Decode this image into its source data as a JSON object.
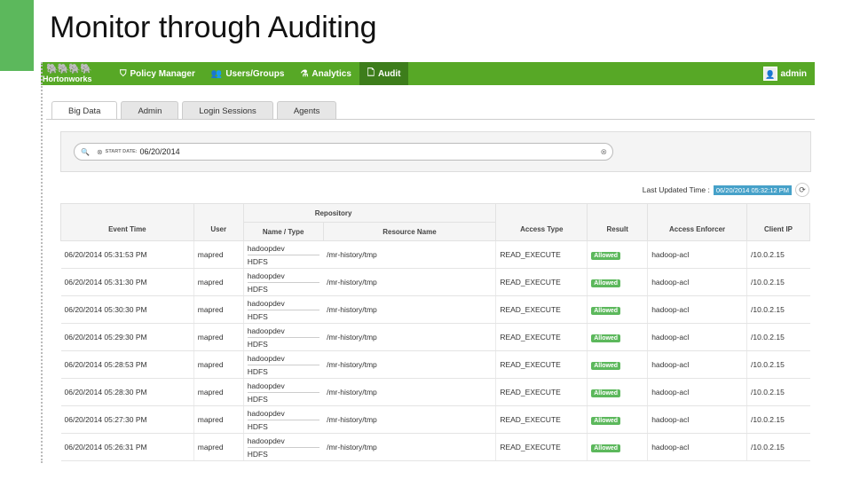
{
  "slide": {
    "title": "Monitor through Auditing"
  },
  "nav": {
    "logo_text": "Hortonworks",
    "items": [
      {
        "icon": "shield-icon",
        "label": "Policy Manager",
        "active": false
      },
      {
        "icon": "users-icon",
        "label": "Users/Groups",
        "active": false
      },
      {
        "icon": "flask-icon",
        "label": "Analytics",
        "active": false
      },
      {
        "icon": "document-icon",
        "label": "Audit",
        "active": true
      }
    ],
    "user": "admin"
  },
  "tabs": [
    {
      "label": "Big Data",
      "active": true
    },
    {
      "label": "Admin",
      "active": false
    },
    {
      "label": "Login Sessions",
      "active": false
    },
    {
      "label": "Agents",
      "active": false
    }
  ],
  "search": {
    "filter_label": "START DATE:",
    "filter_value": "06/20/2014"
  },
  "last_updated": {
    "label": "Last Updated Time :",
    "value": "06/20/2014 05:32:12 PM"
  },
  "table": {
    "group_header": "Repository",
    "headers": {
      "event_time": "Event Time",
      "user": "User",
      "name_type": "Name / Type",
      "resource": "Resource Name",
      "access_type": "Access Type",
      "result": "Result",
      "enforcer": "Access Enforcer",
      "client_ip": "Client IP"
    },
    "rows": [
      {
        "time": "06/20/2014 05:31:53 PM",
        "user": "mapred",
        "repo": "hadoopdev",
        "type": "HDFS",
        "resource": "/mr-history/tmp",
        "access": "READ_EXECUTE",
        "result": "Allowed",
        "enforcer": "hadoop-acl",
        "ip": "/10.0.2.15"
      },
      {
        "time": "06/20/2014 05:31:30 PM",
        "user": "mapred",
        "repo": "hadoopdev",
        "type": "HDFS",
        "resource": "/mr-history/tmp",
        "access": "READ_EXECUTE",
        "result": "Allowed",
        "enforcer": "hadoop-acl",
        "ip": "/10.0.2.15"
      },
      {
        "time": "06/20/2014 05:30:30 PM",
        "user": "mapred",
        "repo": "hadoopdev",
        "type": "HDFS",
        "resource": "/mr-history/tmp",
        "access": "READ_EXECUTE",
        "result": "Allowed",
        "enforcer": "hadoop-acl",
        "ip": "/10.0.2.15"
      },
      {
        "time": "06/20/2014 05:29:30 PM",
        "user": "mapred",
        "repo": "hadoopdev",
        "type": "HDFS",
        "resource": "/mr-history/tmp",
        "access": "READ_EXECUTE",
        "result": "Allowed",
        "enforcer": "hadoop-acl",
        "ip": "/10.0.2.15"
      },
      {
        "time": "06/20/2014 05:28:53 PM",
        "user": "mapred",
        "repo": "hadoopdev",
        "type": "HDFS",
        "resource": "/mr-history/tmp",
        "access": "READ_EXECUTE",
        "result": "Allowed",
        "enforcer": "hadoop-acl",
        "ip": "/10.0.2.15"
      },
      {
        "time": "06/20/2014 05:28:30 PM",
        "user": "mapred",
        "repo": "hadoopdev",
        "type": "HDFS",
        "resource": "/mr-history/tmp",
        "access": "READ_EXECUTE",
        "result": "Allowed",
        "enforcer": "hadoop-acl",
        "ip": "/10.0.2.15"
      },
      {
        "time": "06/20/2014 05:27:30 PM",
        "user": "mapred",
        "repo": "hadoopdev",
        "type": "HDFS",
        "resource": "/mr-history/tmp",
        "access": "READ_EXECUTE",
        "result": "Allowed",
        "enforcer": "hadoop-acl",
        "ip": "/10.0.2.15"
      },
      {
        "time": "06/20/2014 05:26:31 PM",
        "user": "mapred",
        "repo": "hadoopdev",
        "type": "HDFS",
        "resource": "/mr-history/tmp",
        "access": "READ_EXECUTE",
        "result": "Allowed",
        "enforcer": "hadoop-acl",
        "ip": "/10.0.2.15"
      }
    ]
  },
  "colors": {
    "nav_green": "#57a826",
    "accent_green": "#5cb85c",
    "timestamp_blue": "#46a1c9"
  }
}
